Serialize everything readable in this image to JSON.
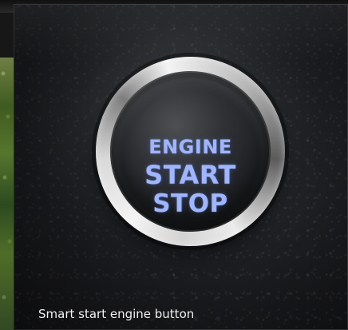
{
  "button": {
    "line1": "ENGINE",
    "line2": "START",
    "line3": "STOP"
  },
  "caption": "Smart start engine button",
  "icons": {
    "engine_button": "engine-start-stop-button-icon"
  },
  "colors": {
    "button_text": "#9fb5ff",
    "leather": "#2c2f33",
    "chrome": "#d9d9d9",
    "grass": "#4f6d28"
  }
}
